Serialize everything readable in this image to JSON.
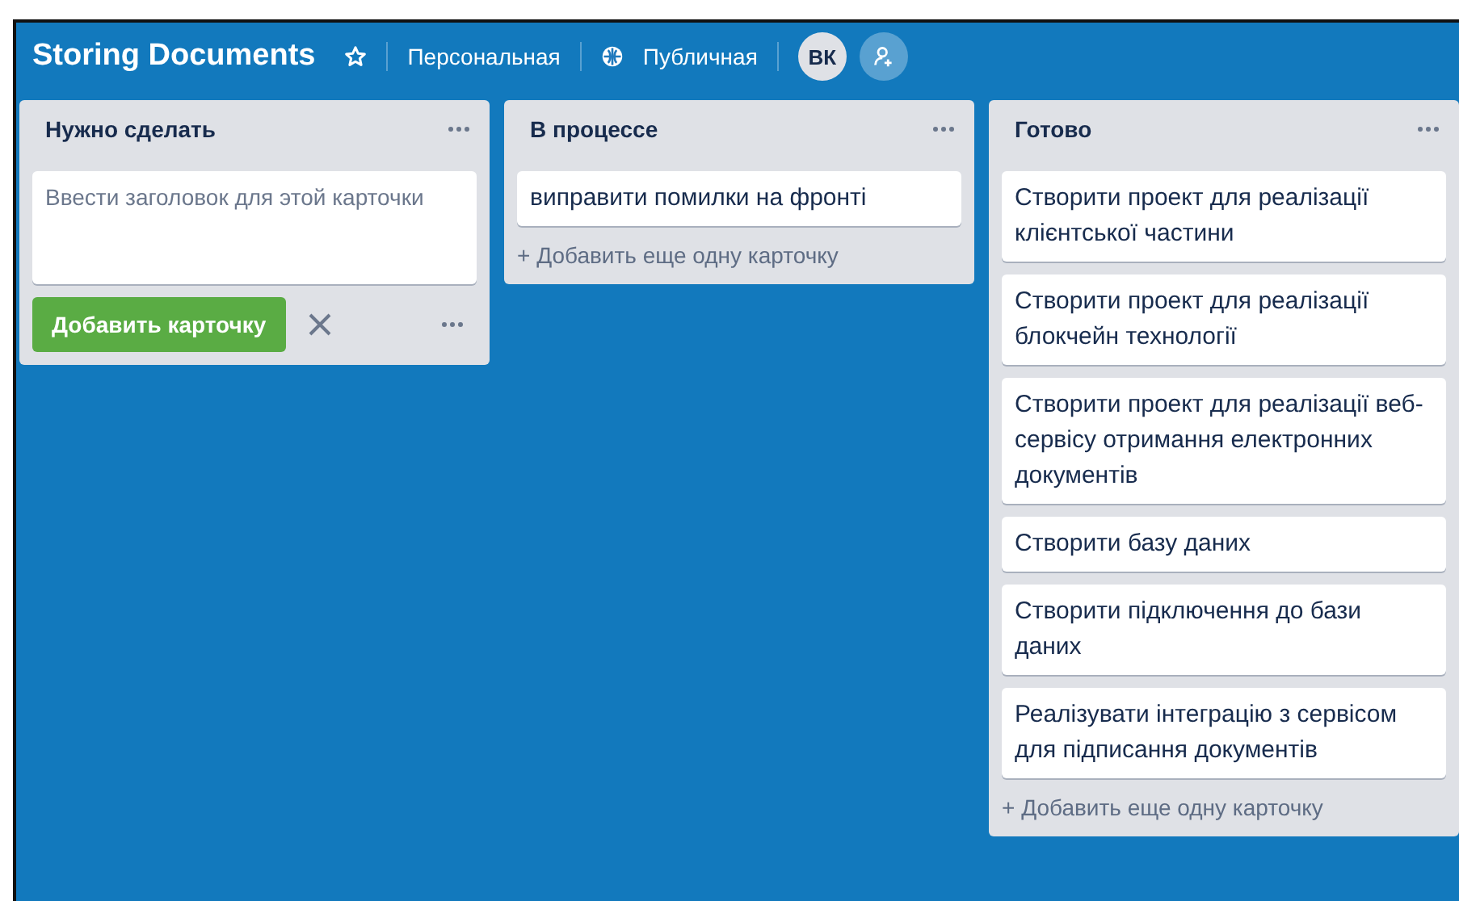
{
  "header": {
    "title": "Storing Documents",
    "team": "Персональная",
    "visibility": "Публичная",
    "avatar": "ВК"
  },
  "lists": [
    {
      "title": "Нужно сделать",
      "composer": {
        "placeholder": "Ввести заголовок для этой карточки",
        "submit": "Добавить карточку"
      }
    },
    {
      "title": "В процессе",
      "cards": [
        "виправити помилки на фронті"
      ],
      "add_card": "+ Добавить еще одну карточку"
    },
    {
      "title": "Готово",
      "cards": [
        "Створити проект для реалізації клієнтської частини",
        "Створити проект для реалізації блокчейн технології",
        "Створити проект для реалізації веб-сервісу отримання електронних документів",
        "Створити базу даних",
        "Створити підключення до бази даних",
        "Реалізувати інтеграцію з сервісом для підписання документів"
      ],
      "add_card": "+ Добавить еще одну карточку"
    }
  ]
}
